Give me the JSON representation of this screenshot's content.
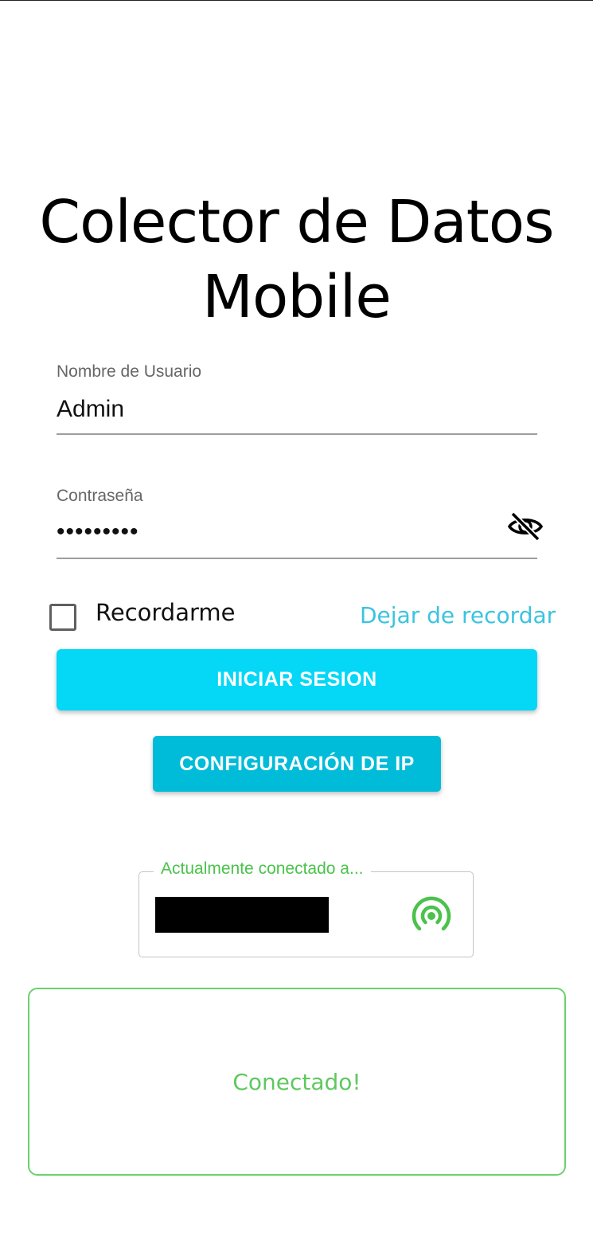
{
  "app": {
    "title_line1": "Colector de Datos",
    "title_line2": "Mobile"
  },
  "login_form": {
    "username": {
      "label": "Nombre de Usuario",
      "value": "Admin"
    },
    "password": {
      "label": "Contraseña",
      "value": "•••••••••",
      "visibility_icon": "eye-off-icon"
    },
    "remember": {
      "label": "Recordarme",
      "checked": false
    },
    "forget_link": "Dejar de recordar",
    "login_button": "INICIAR SESION",
    "ip_config_button": "CONFIGURACIÓN DE IP"
  },
  "connection": {
    "legend": "Actualmente conectado a...",
    "status_icon": "wifi-tethering-icon",
    "status_message": "Conectado!"
  },
  "colors": {
    "primary": "#05d7f6",
    "secondary": "#00bcd9",
    "link": "#3cc3e0",
    "success": "#4bc24b"
  }
}
